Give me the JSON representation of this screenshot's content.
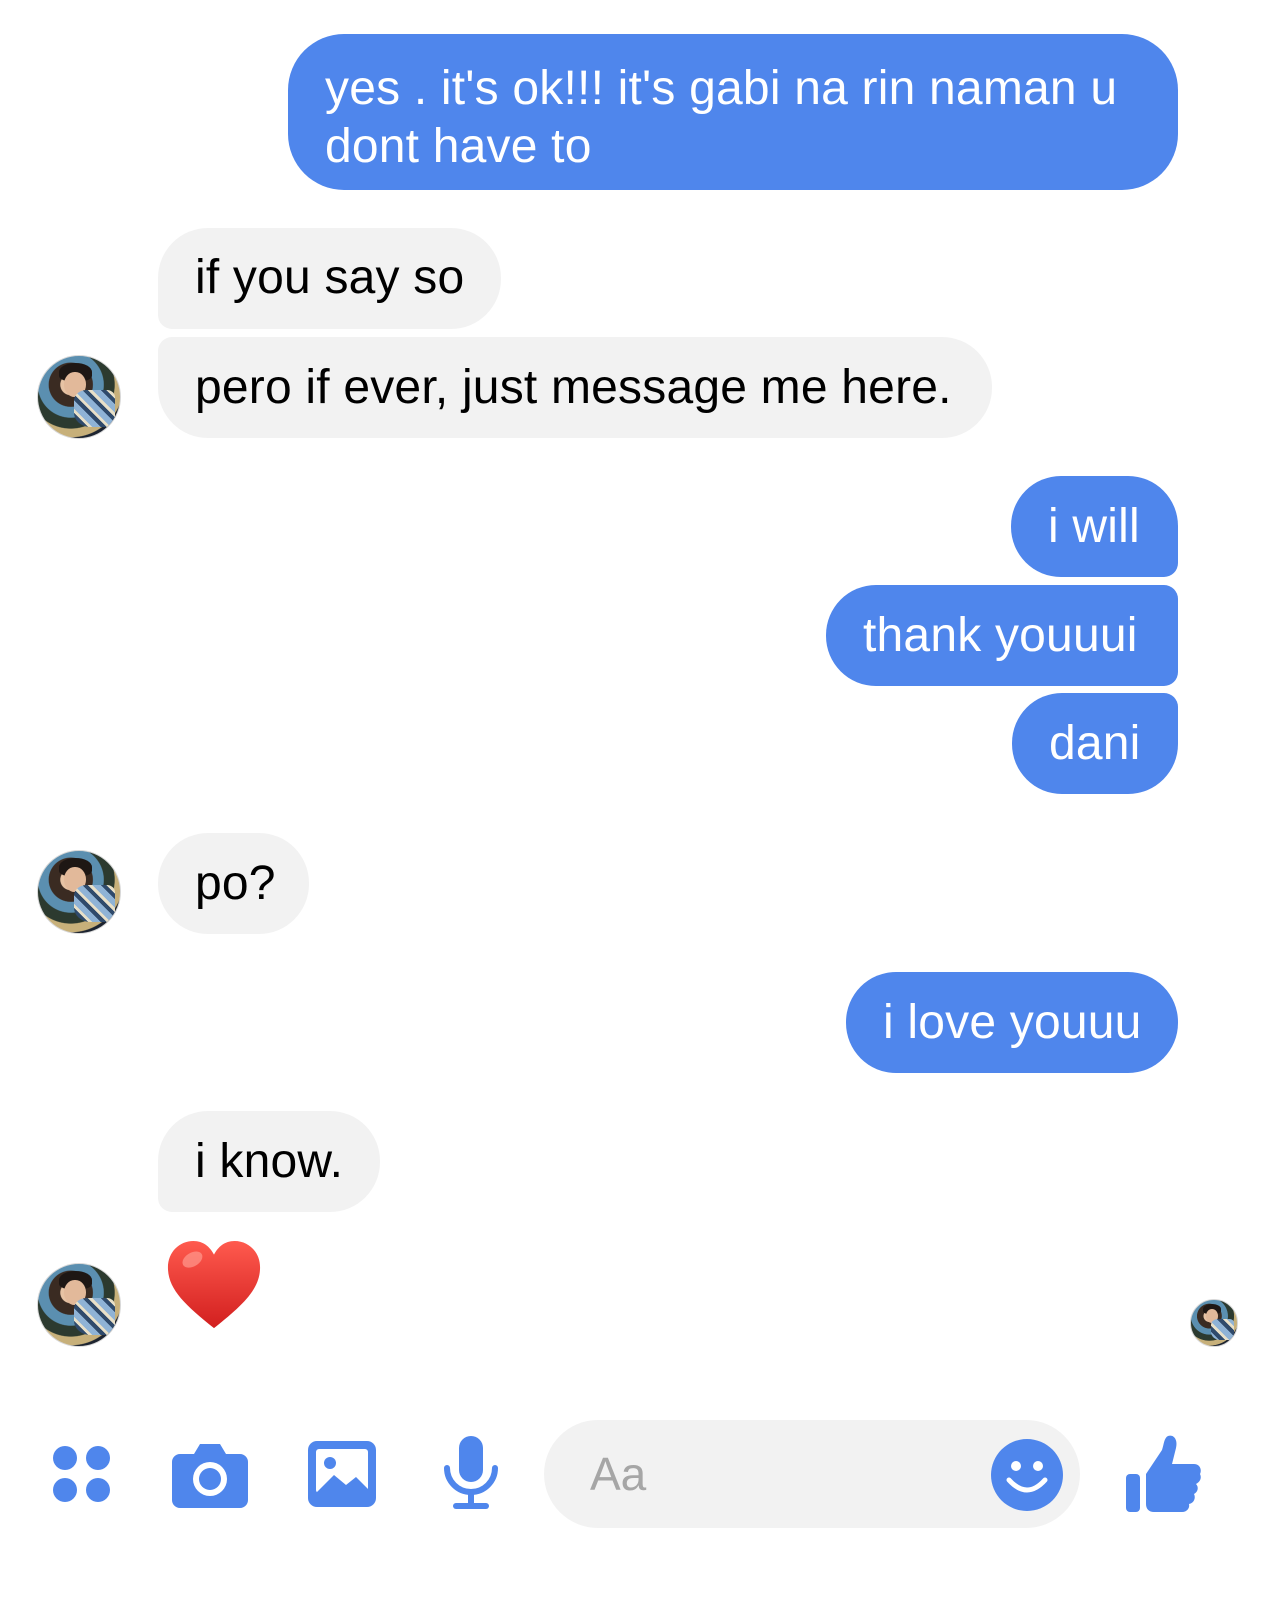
{
  "messages": [
    {
      "sender": "me",
      "text": "yes . it's ok!!! it's gabi na rin naman u dont have to"
    },
    {
      "sender": "them",
      "text": "if you say so"
    },
    {
      "sender": "them",
      "text": "pero if ever, just message me here."
    },
    {
      "sender": "me",
      "text": "i will"
    },
    {
      "sender": "me",
      "text": "thank youuui"
    },
    {
      "sender": "me",
      "text": "dani"
    },
    {
      "sender": "them",
      "text": "po?"
    },
    {
      "sender": "me",
      "text": "i love youuu"
    },
    {
      "sender": "them",
      "text": "i know."
    },
    {
      "sender": "them",
      "emoji": "red-heart"
    }
  ],
  "composer": {
    "placeholder": "Aa",
    "icons": [
      "apps-icon",
      "camera-icon",
      "image-icon",
      "microphone-icon",
      "emoji-icon",
      "thumbs-up-icon"
    ]
  },
  "colors": {
    "outgoing_bubble": "#4f86ec",
    "incoming_bubble": "#f2f2f2",
    "accent": "#4f86ec",
    "heart": "#e8322f"
  }
}
